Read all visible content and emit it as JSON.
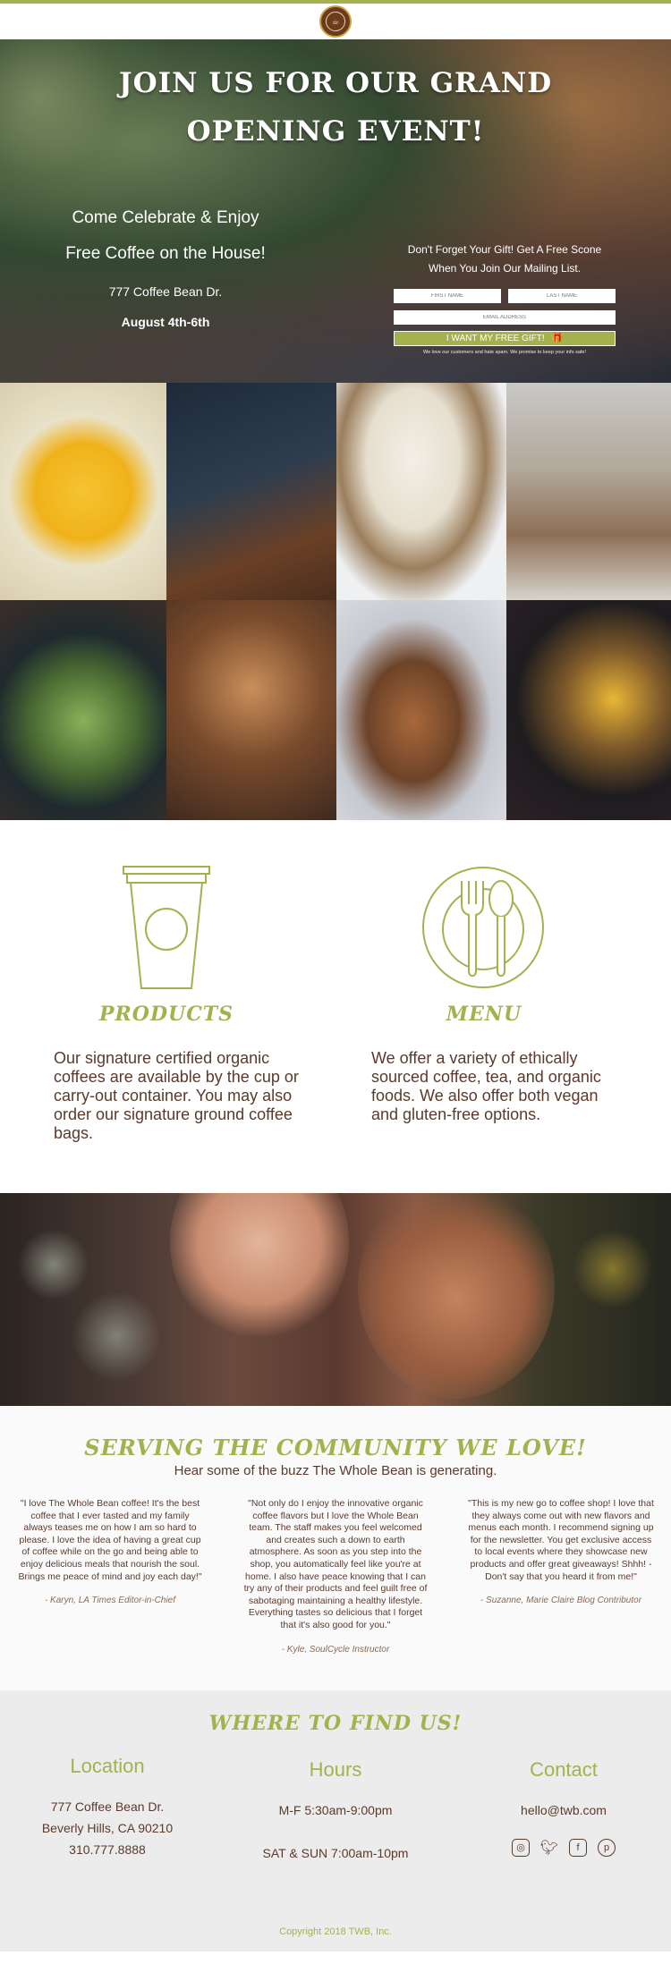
{
  "header": {
    "logo_alt": "The Whole Bean"
  },
  "hero": {
    "title": "JOIN US FOR OUR GRAND OPENING EVENT!",
    "left": {
      "line1": "Come Celebrate & Enjoy",
      "line2": "Free Coffee on the House!",
      "address": "777 Coffee Bean Dr.",
      "dates": "August 4th-6th"
    },
    "right": {
      "promo_line1": "Don't Forget Your Gift! Get A Free Scone",
      "promo_line2": "When You Join Our Mailing List.",
      "first_name_placeholder": "FIRST NAME",
      "last_name_placeholder": "LAST NAME",
      "email_placeholder": "EMAIL ADDRESS",
      "cta_label": "I WANT MY FREE GIFT!",
      "fineprint": "We love our customers and hate spam. We promise to keep your info safe!"
    }
  },
  "features": {
    "products": {
      "title": "PRODUCTS",
      "body": "Our signature certified organic coffees are available by the cup or  carry-out container. You may also order our signature ground coffee bags."
    },
    "menu": {
      "title": "MENU",
      "body": "We offer a variety of ethically sourced coffee, tea, and organic foods. We also offer both vegan and gluten-free options."
    }
  },
  "community": {
    "title": "SERVING THE COMMUNITY WE LOVE!",
    "subtitle": "Hear some of the buzz The Whole Bean is generating.",
    "testimonials": [
      {
        "text": "\"I love The Whole Bean coffee! It's the best coffee that I ever tasted and my family always teases me on how I am so hard to please. I love the idea of having a great cup of coffee while on the go and being able to enjoy delicious meals that nourish the soul. Brings me peace of mind and joy each day!\"",
        "author": "- Karyn, LA Times Editor-in-Chief"
      },
      {
        "text": "\"Not only do I enjoy the innovative organic coffee flavors but I love the Whole Bean team. The staff makes you feel welcomed and creates such a down to earth atmosphere. As soon as you step into the shop, you automatically feel like you're at home. I also have peace knowing that I can try any of their products and feel guilt free of sabotaging maintaining a healthy lifestyle. Everything tastes so delicious that I forget that it's also good for you.\"",
        "author": "- Kyle, SoulCycle Instructor"
      },
      {
        "text": "\"This is my new go to coffee shop! I love that they always come out with new flavors and menus each month. I recommend signing up for the newsletter. You get exclusive access to local events where they showcase new products and offer great giveaways! Shhh! - Don't say that you heard it from me!\"",
        "author": "- Suzanne, Marie Claire Blog Contributor"
      }
    ]
  },
  "findus": {
    "title": "WHERE TO FIND US!",
    "location": {
      "heading": "Location",
      "line1": "777 Coffee Bean Dr.",
      "line2": "Beverly Hills, CA 90210",
      "line3": "310.777.8888"
    },
    "hours": {
      "heading": "Hours",
      "line1": "M-F 5:30am-9:00pm",
      "line2": "SAT & SUN 7:00am-10pm"
    },
    "contact": {
      "heading": "Contact",
      "email": "hello@twb.com",
      "socials": [
        "instagram-icon",
        "twitter-icon",
        "facebook-icon",
        "pinterest-icon"
      ]
    },
    "copyright": "Copyright 2018 TWB, Inc."
  },
  "colors": {
    "accent": "#a4b24e",
    "text": "#5b3a2c"
  }
}
